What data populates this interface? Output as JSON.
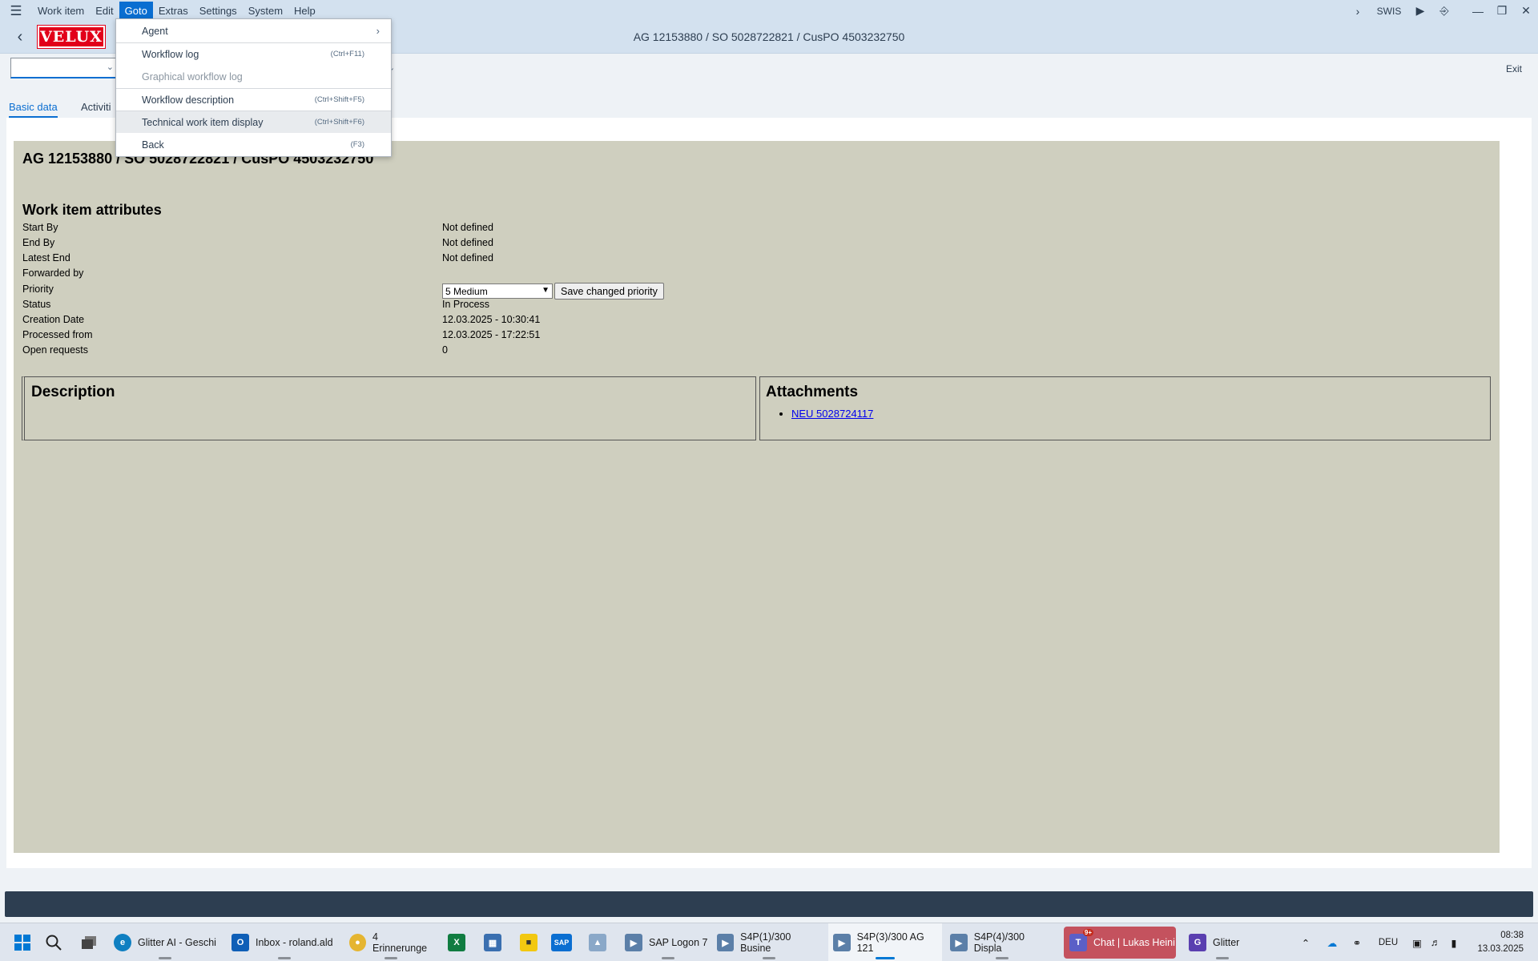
{
  "menubar": {
    "items": [
      {
        "label": "Work item"
      },
      {
        "label": "Edit"
      },
      {
        "label": "Goto",
        "active": true
      },
      {
        "label": "Extras"
      },
      {
        "label": "Settings"
      },
      {
        "label": "System"
      },
      {
        "label": "Help"
      }
    ],
    "system_id": "SWIS"
  },
  "titlebar": {
    "logo_text": "VELUX",
    "title": "AG 12153880 / SO 5028722821 / CusPO 4503232750"
  },
  "toolbar": {
    "exit_label": "Exit"
  },
  "tabs": [
    {
      "label": "Basic data",
      "selected": true
    },
    {
      "label": "Activiti"
    }
  ],
  "content": {
    "heading": "AG 12153880 / SO 5028722821 / CusPO 4503232750",
    "attributes_heading": "Work item attributes",
    "attributes": [
      {
        "label": "Start By",
        "value": "Not defined"
      },
      {
        "label": "End By",
        "value": "Not defined"
      },
      {
        "label": "Latest End",
        "value": "Not defined"
      },
      {
        "label": "Forwarded by",
        "value": ""
      },
      {
        "label": "Priority",
        "value": ""
      },
      {
        "label": "Status",
        "value": "In Process"
      },
      {
        "label": "Creation Date",
        "value": "12.03.2025 - 10:30:41"
      },
      {
        "label": "Processed from",
        "value": "12.03.2025 - 17:22:51"
      },
      {
        "label": "Open requests",
        "value": "0"
      }
    ],
    "priority_selected": "5 Medium",
    "save_priority_label": "Save changed priority",
    "description_heading": "Description",
    "attachments_heading": "Attachments",
    "attachments": [
      "NEU 5028724117"
    ]
  },
  "goto_menu": {
    "items": [
      {
        "label": "Agent",
        "shortcut": "",
        "submenu": true
      },
      {
        "label": "Workflow log",
        "shortcut": "(Ctrl+F11)"
      },
      {
        "label": "Graphical workflow log",
        "shortcut": "",
        "disabled": true
      },
      {
        "label": "Workflow description",
        "shortcut": "(Ctrl+Shift+F5)"
      },
      {
        "label": "Technical work item display",
        "shortcut": "(Ctrl+Shift+F6)",
        "hover": true
      },
      {
        "label": "Back",
        "shortcut": "(F3)"
      }
    ]
  },
  "taskbar": {
    "apps": [
      {
        "label": "Glitter AI - Geschi"
      },
      {
        "label": "Inbox - roland.ald"
      },
      {
        "label": "4 Erinnerunge"
      },
      {
        "label": "SAP Logon 7"
      },
      {
        "label": "S4P(1)/300 Busine"
      },
      {
        "label": "S4P(3)/300 AG 121"
      },
      {
        "label": "S4P(4)/300 Displa"
      },
      {
        "label": "Chat | Lukas Heini"
      },
      {
        "label": "Glitter"
      }
    ],
    "teams_badge": "9+",
    "sap_icon_text": "SAP",
    "language": "DEU",
    "time": "08:38",
    "date": "13.03.2025"
  },
  "colors": {
    "sap_shell": "#d3e1ef",
    "accent": "#0a6ed1",
    "content_bg": "#cfcfbf",
    "status_bar": "#2d3e51",
    "velux_red": "#e2001a"
  }
}
